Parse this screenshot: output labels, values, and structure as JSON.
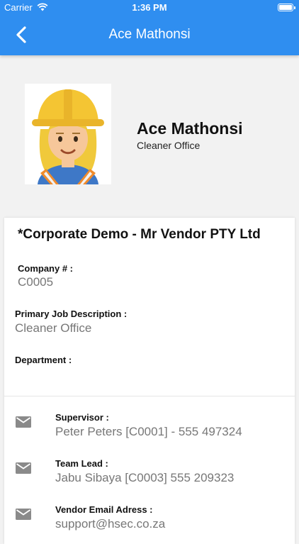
{
  "status_bar": {
    "carrier": "Carrier",
    "time": "1:36 PM"
  },
  "nav": {
    "title": "Ace Mathonsi",
    "back_icon": "chevron-left-icon"
  },
  "profile": {
    "name": "Ace Mathonsi",
    "role": "Cleaner Office",
    "avatar_icon": "woman-construction-worker-icon"
  },
  "details": {
    "company_name": "*Corporate Demo - Mr Vendor PTY Ltd",
    "company_number_label": "Company # :",
    "company_number": "C0005",
    "job_description_label": "Primary Job Description :",
    "job_description": "Cleaner Office",
    "department_label": "Department :",
    "department": ""
  },
  "contacts": [
    {
      "label": "Supervisor :",
      "value": "Peter Peters [C0001] - 555 497324",
      "icon": "mail-icon"
    },
    {
      "label": "Team Lead :",
      "value": "Jabu Sibaya [C0003] 555 209323",
      "icon": "mail-icon"
    },
    {
      "label": "Vendor Email Adress :",
      "value": "support@hsec.co.za",
      "icon": "mail-icon"
    }
  ],
  "colors": {
    "header": "#2f8ef0",
    "background": "#f2f2f2",
    "value_text": "#777777"
  }
}
